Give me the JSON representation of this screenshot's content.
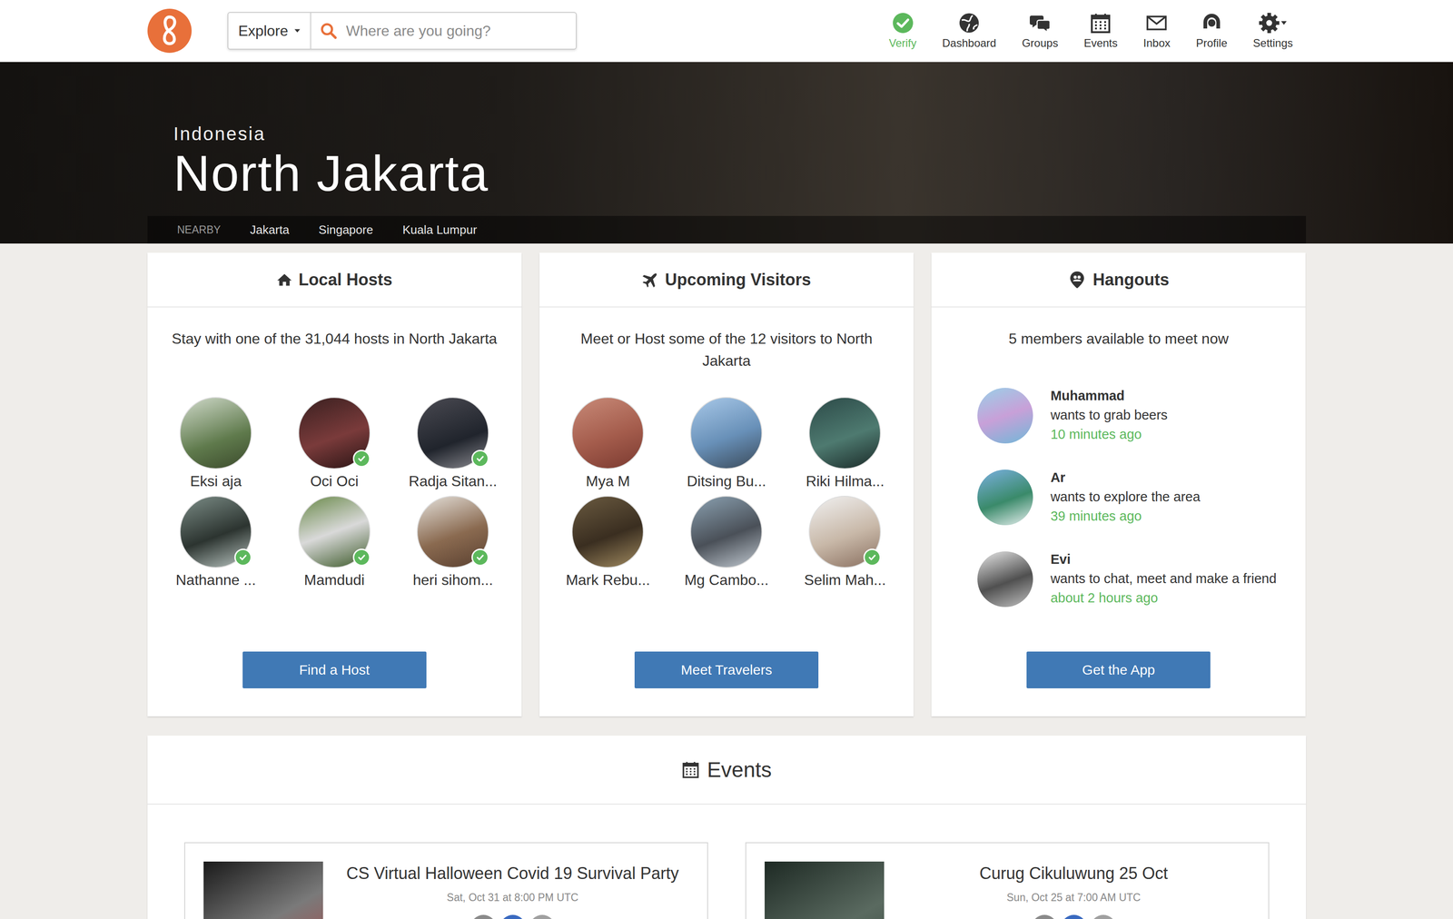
{
  "search": {
    "mode": "Explore",
    "placeholder": "Where are you going?"
  },
  "nav": [
    {
      "label": "Verify",
      "highlighted": true
    },
    {
      "label": "Dashboard",
      "highlighted": false
    },
    {
      "label": "Groups",
      "highlighted": false
    },
    {
      "label": "Events",
      "highlighted": false
    },
    {
      "label": "Inbox",
      "highlighted": false
    },
    {
      "label": "Profile",
      "highlighted": false
    },
    {
      "label": "Settings",
      "highlighted": false
    }
  ],
  "hero": {
    "country": "Indonesia",
    "city": "North Jakarta",
    "nearby_label": "NEARBY",
    "nearby": [
      "Jakarta",
      "Singapore",
      "Kuala Lumpur"
    ]
  },
  "local_hosts": {
    "title": "Local Hosts",
    "summary": "Stay with one of the 31,044 hosts in North Jakarta",
    "people": [
      {
        "name": "Eksi aja",
        "verified": false
      },
      {
        "name": "Oci Oci",
        "verified": true
      },
      {
        "name": "Radja Sitan...",
        "verified": true
      },
      {
        "name": "Nathanne ...",
        "verified": true
      },
      {
        "name": "Mamdudi",
        "verified": true
      },
      {
        "name": "heri sihom...",
        "verified": true
      }
    ],
    "button": "Find a Host"
  },
  "upcoming_visitors": {
    "title": "Upcoming Visitors",
    "summary": "Meet or Host some of the 12 visitors to North Jakarta",
    "people": [
      {
        "name": "Mya M",
        "verified": false
      },
      {
        "name": "Ditsing Bu...",
        "verified": false
      },
      {
        "name": "Riki Hilma...",
        "verified": false
      },
      {
        "name": "Mark Rebu...",
        "verified": false
      },
      {
        "name": "Mg Cambo...",
        "verified": false
      },
      {
        "name": "Selim Mah...",
        "verified": true
      }
    ],
    "button": "Meet Travelers"
  },
  "hangouts": {
    "title": "Hangouts",
    "summary": "5 members available to meet now",
    "members": [
      {
        "name": "Muhammad",
        "activity": "wants to grab beers",
        "time": "10 minutes ago"
      },
      {
        "name": "Ar",
        "activity": "wants to explore the area",
        "time": "39 minutes ago"
      },
      {
        "name": "Evi",
        "activity": "wants to chat, meet and make a friend",
        "time": "about 2 hours ago"
      }
    ],
    "button": "Get the App"
  },
  "events": {
    "title": "Events",
    "items": [
      {
        "title": "CS Virtual Halloween Covid 19 Survival Party",
        "date": "Sat, Oct 31 at 8:00 PM UTC",
        "attendees": 3
      },
      {
        "title": "Curug Cikuluwung 25 Oct",
        "date": "Sun, Oct 25 at 7:00 AM UTC",
        "attendees": 3
      }
    ]
  }
}
